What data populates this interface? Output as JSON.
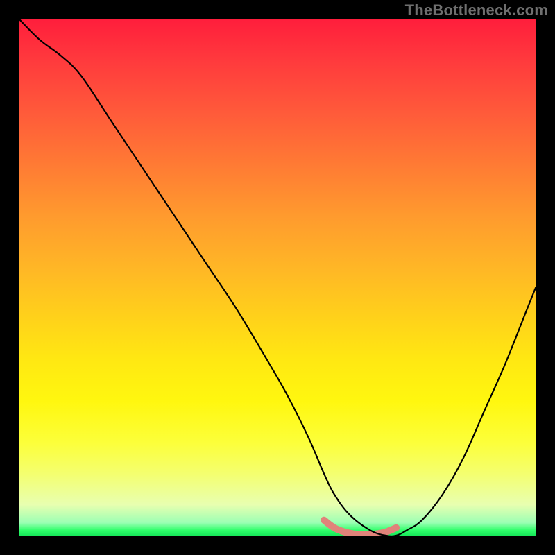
{
  "watermark": {
    "text": "TheBottleneck.com"
  },
  "chart_data": {
    "type": "line",
    "title": "",
    "xlabel": "",
    "ylabel": "",
    "xlim": [
      0,
      100
    ],
    "ylim": [
      0,
      100
    ],
    "grid": false,
    "legend": false,
    "series": [
      {
        "name": "main-curve",
        "color": "#000000",
        "x": [
          0,
          4,
          8,
          12,
          18,
          24,
          30,
          36,
          42,
          48,
          52,
          56,
          59,
          61,
          64,
          68,
          71,
          73,
          75,
          78,
          82,
          86,
          90,
          94,
          98,
          100
        ],
        "values": [
          100,
          96,
          93,
          89,
          80,
          71,
          62,
          53,
          44,
          34,
          27,
          19,
          12,
          8,
          4,
          1,
          0,
          0,
          1,
          3,
          8,
          15,
          24,
          33,
          43,
          48
        ]
      },
      {
        "name": "bottom-highlight",
        "color": "#e0837a",
        "x": [
          59,
          61,
          63,
          65,
          67,
          69,
          71,
          73
        ],
        "values": [
          3,
          1.5,
          0.7,
          0.3,
          0.2,
          0.3,
          0.7,
          1.5
        ]
      }
    ],
    "background_gradient": {
      "direction": "vertical",
      "stops": [
        {
          "offset": 0.0,
          "color": "#ff1e3c"
        },
        {
          "offset": 0.3,
          "color": "#ff7a34"
        },
        {
          "offset": 0.6,
          "color": "#ffd21a"
        },
        {
          "offset": 0.82,
          "color": "#fcff3a"
        },
        {
          "offset": 0.97,
          "color": "#9cffb4"
        },
        {
          "offset": 1.0,
          "color": "#17e85a"
        }
      ]
    }
  }
}
